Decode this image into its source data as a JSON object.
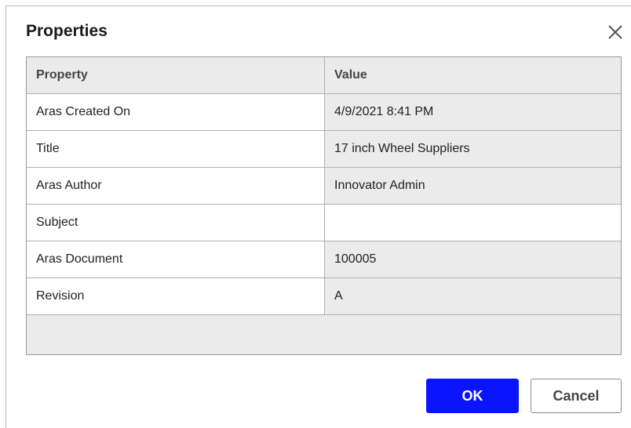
{
  "dialog": {
    "title": "Properties",
    "close_icon": "close-icon"
  },
  "table": {
    "headers": [
      "Property",
      "Value"
    ],
    "rows": [
      {
        "property": "Aras Created On",
        "value": "4/9/2021 8:41 PM"
      },
      {
        "property": "Title",
        "value": "17 inch Wheel Suppliers"
      },
      {
        "property": "Aras Author",
        "value": "Innovator Admin"
      },
      {
        "property": "Subject",
        "value": ""
      },
      {
        "property": "Aras Document",
        "value": "100005"
      },
      {
        "property": "Revision",
        "value": "A"
      }
    ]
  },
  "buttons": {
    "ok_label": "OK",
    "cancel_label": "Cancel"
  },
  "colors": {
    "primary": "#0a14ff",
    "header_bg": "#ebebeb",
    "border": "#8f9aa3"
  }
}
